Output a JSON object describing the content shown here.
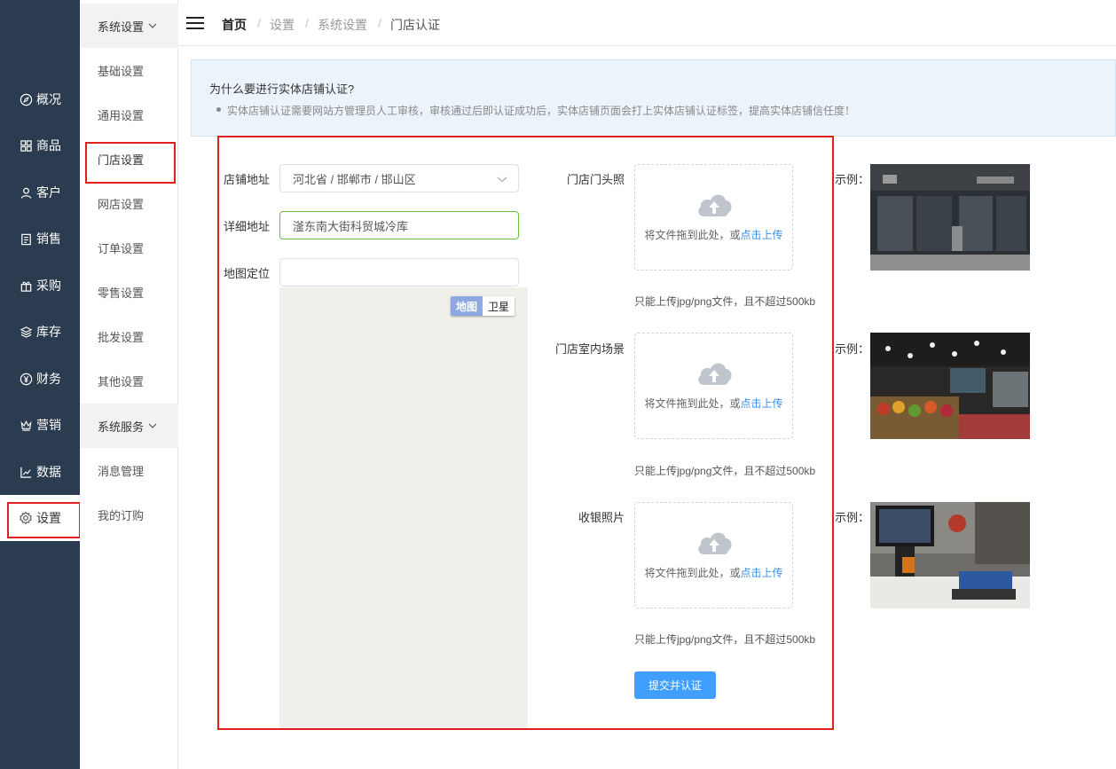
{
  "nav": {
    "items": [
      {
        "label": "概况",
        "icon": "compass-icon"
      },
      {
        "label": "商品",
        "icon": "grid-icon"
      },
      {
        "label": "客户",
        "icon": "user-icon"
      },
      {
        "label": "销售",
        "icon": "clipboard-icon"
      },
      {
        "label": "采购",
        "icon": "gift-icon"
      },
      {
        "label": "库存",
        "icon": "layers-icon"
      },
      {
        "label": "财务",
        "icon": "yen-icon"
      },
      {
        "label": "营销",
        "icon": "crown-icon"
      },
      {
        "label": "数据",
        "icon": "chart-icon"
      },
      {
        "label": "设置",
        "icon": "gear-icon"
      }
    ]
  },
  "submenu": {
    "group1": "系统设置",
    "items1": [
      "基础设置",
      "通用设置",
      "门店设置",
      "网店设置",
      "订单设置",
      "零售设置",
      "批发设置",
      "其他设置"
    ],
    "group2": "系统服务",
    "items2": [
      "消息管理",
      "我的订购"
    ]
  },
  "breadcrumb": [
    "首页",
    "设置",
    "系统设置",
    "门店认证"
  ],
  "banner": {
    "title": "为什么要进行实体店铺认证?",
    "text": "实体店铺认证需要网站方管理员人工审核，审核通过后即认证成功后，实体店铺页面会打上实体店铺认证标签，提高实体店铺信任度！"
  },
  "form": {
    "address_label": "店铺地址",
    "address_value": "河北省 / 邯郸市 / 邯山区",
    "detail_label": "详细地址",
    "detail_value": "滏东南大街科贸城冷库",
    "map_label": "地图定位",
    "map_value": "",
    "map_btn_map": "地图",
    "map_btn_sat": "卫星",
    "uploads": [
      {
        "label": "门店门头照",
        "text": "将文件拖到此处，或",
        "link": "点击上传",
        "hint": "只能上传jpg/png文件，且不超过500kb"
      },
      {
        "label": "门店室内场景",
        "text": "将文件拖到此处，或",
        "link": "点击上传",
        "hint": "只能上传jpg/png文件，且不超过500kb"
      },
      {
        "label": "收银照片",
        "text": "将文件拖到此处，或",
        "link": "点击上传",
        "hint": "只能上传jpg/png文件，且不超过500kb"
      }
    ],
    "example_label": "示例：",
    "submit": "提交并认证"
  },
  "colors": {
    "nav_bg": "#2b3b50",
    "accent": "#409eff",
    "highlight": "#e02020",
    "input_focus": "#67c23a"
  }
}
